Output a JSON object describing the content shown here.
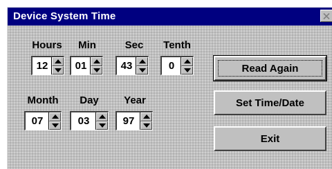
{
  "window": {
    "title": "Device System Time"
  },
  "time": {
    "hours": {
      "label": "Hours",
      "value": "12"
    },
    "min": {
      "label": "Min",
      "value": "01"
    },
    "sec": {
      "label": "Sec",
      "value": "43"
    },
    "tenth": {
      "label": "Tenth",
      "value": "0"
    }
  },
  "date": {
    "month": {
      "label": "Month",
      "value": "07"
    },
    "day": {
      "label": "Day",
      "value": "03"
    },
    "year": {
      "label": "Year",
      "value": "97"
    }
  },
  "buttons": {
    "read_again": "Read Again",
    "set_time_date": "Set Time/Date",
    "exit": "Exit"
  },
  "colors": {
    "titlebar": "#000080",
    "face": "#c0c0c0"
  }
}
